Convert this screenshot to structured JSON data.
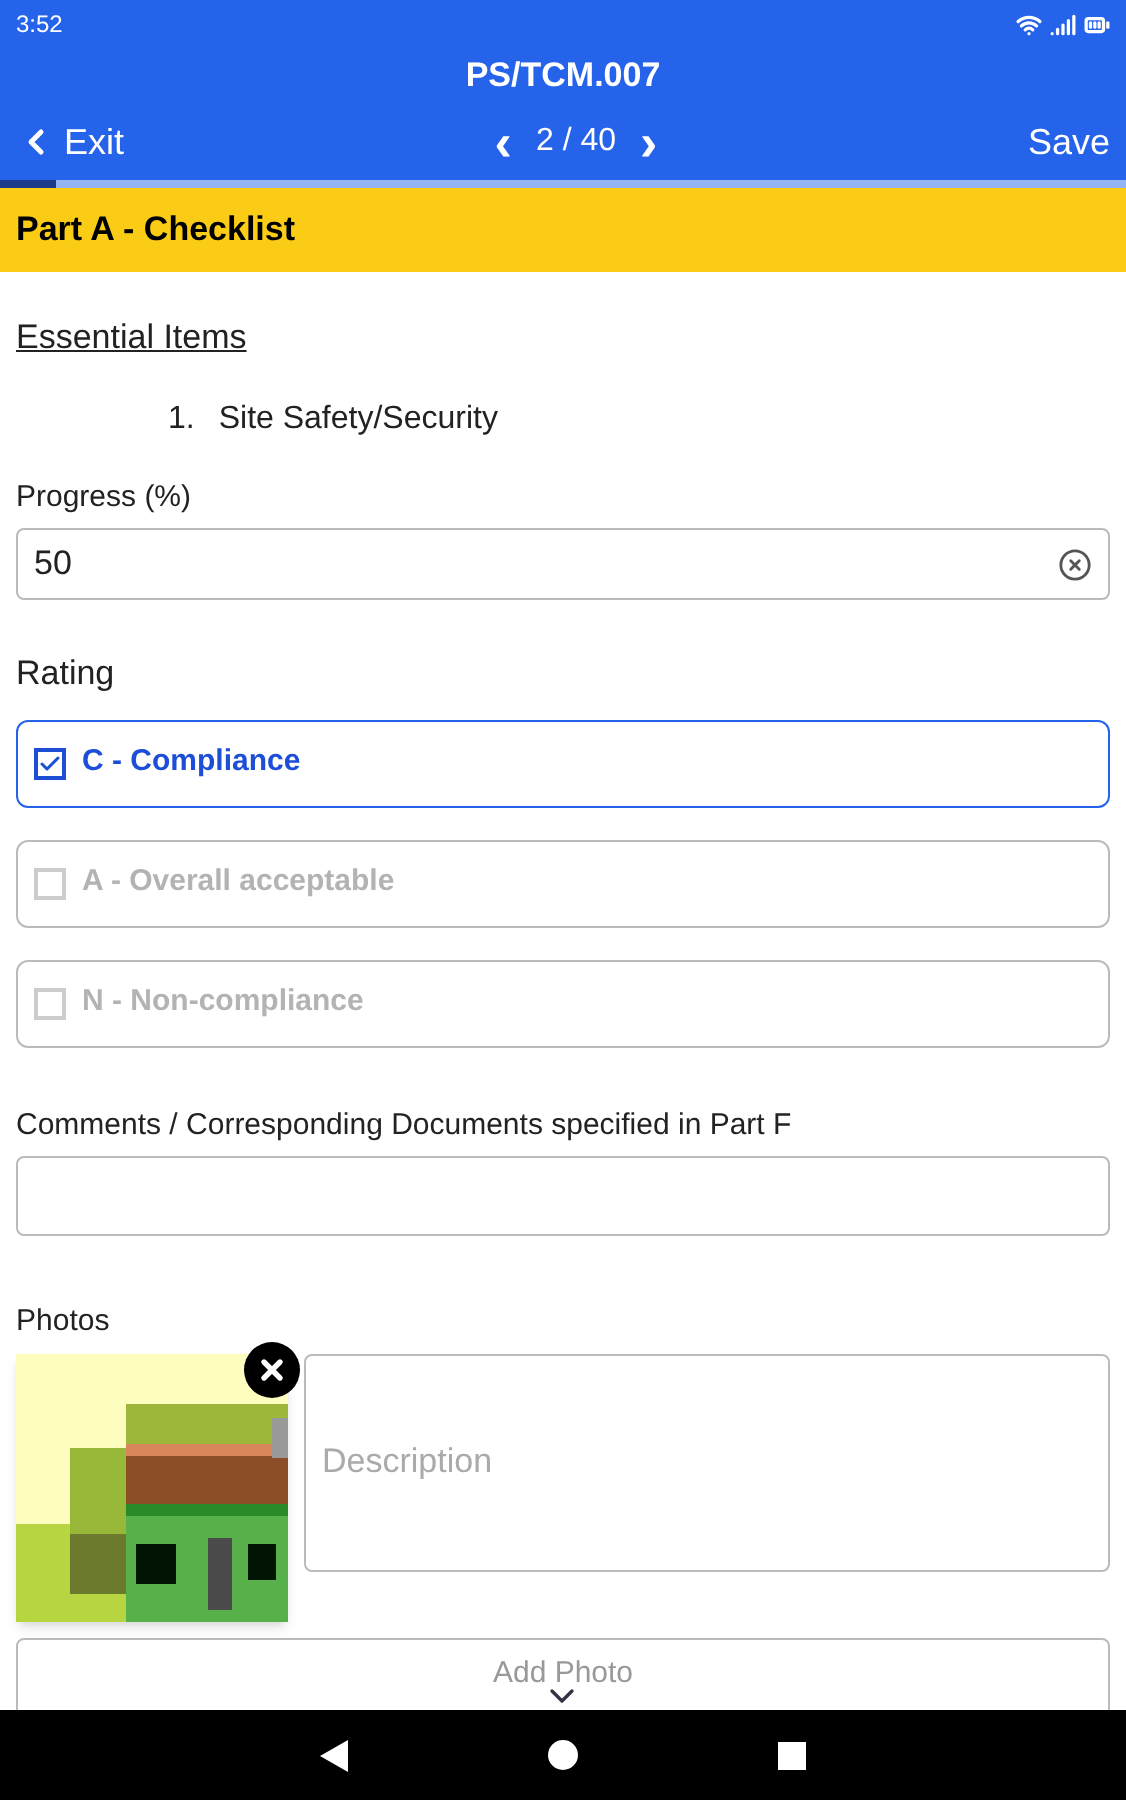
{
  "status_bar": {
    "time": "3:52"
  },
  "header": {
    "title": "PS/TCM.007",
    "back": "Exit",
    "prev": "‹",
    "page": "2 / 40",
    "next": "›",
    "save": "Save",
    "progress": {
      "level": 0.05
    }
  },
  "section": {
    "title": "Part A - Checklist"
  },
  "essential": {
    "heading": "Essential Items",
    "number": "1.",
    "item": "Site Safety/Security"
  },
  "progress_field": {
    "label": "Progress (%)",
    "value": "50"
  },
  "rating": {
    "label": "Rating",
    "options": [
      {
        "label": "C - Compliance",
        "selected": true
      },
      {
        "label": "A - Overall acceptable",
        "selected": false
      },
      {
        "label": "N - Non-compliance",
        "selected": false
      }
    ]
  },
  "comments": {
    "label": "Comments / Corresponding Documents specified in Part F"
  },
  "photos": {
    "label": "Photos",
    "items": [
      {
        "kind": "picture",
        "description_placeholder": "Description"
      }
    ],
    "add_button": "Add Photo"
  }
}
